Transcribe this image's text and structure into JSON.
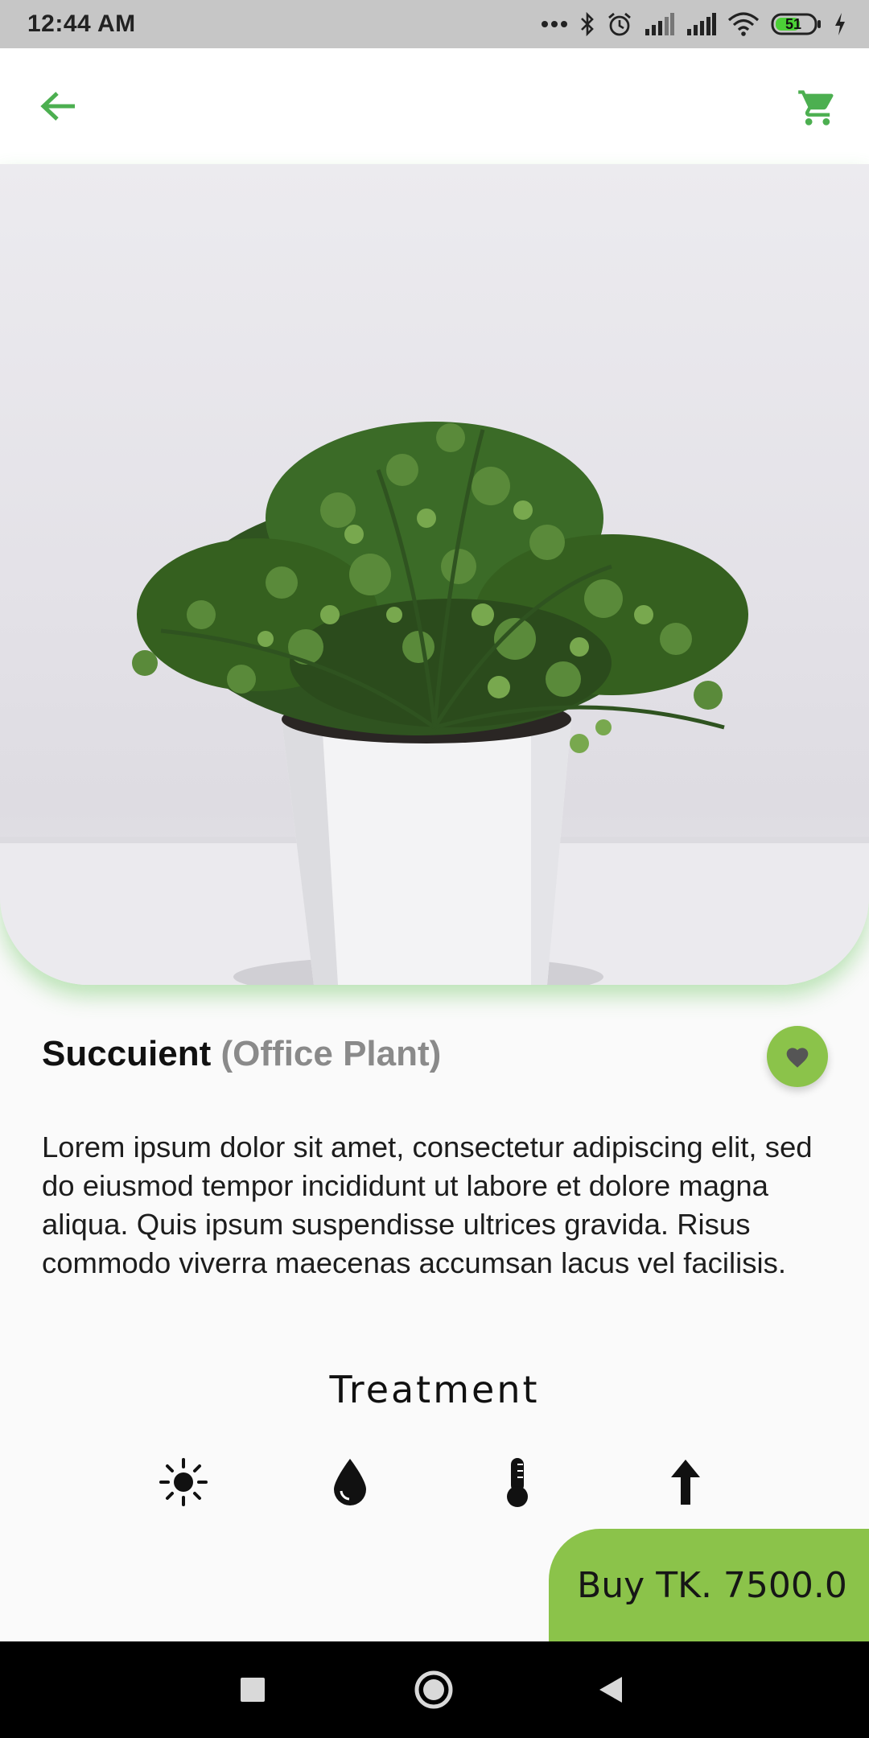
{
  "status_bar": {
    "time": "12:44 AM",
    "battery_level": "51",
    "icons": [
      "more-dots-icon",
      "bluetooth-icon",
      "alarm-icon",
      "signal-icon",
      "signal-icon",
      "wifi-icon",
      "battery-icon",
      "charging-icon"
    ]
  },
  "app_bar": {
    "back_icon": "arrow-left-icon",
    "cart_icon": "cart-icon",
    "accent_color": "#4caf50"
  },
  "product": {
    "image_subject": "potted-plant-image",
    "name": "Succuient",
    "category": "(Office Plant)",
    "favorite_icon": "heart-icon",
    "description": "Lorem ipsum dolor sit amet, consectetur adipiscing elit, sed do eiusmod tempor incididunt ut labore et dolore magna aliqua. Quis ipsum suspendisse ultrices gravida. Risus commodo viverra maecenas accumsan lacus vel facilisis."
  },
  "treatment": {
    "title": "Treatment",
    "icons": [
      "sun-icon",
      "water-drop-icon",
      "thermometer-icon",
      "arrow-up-icon"
    ]
  },
  "buy_button": {
    "label": "Buy TK. 7500.0",
    "color": "#8bc34a"
  },
  "nav_bar": {
    "icons": [
      "recents-square-icon",
      "home-circle-icon",
      "back-triangle-icon"
    ]
  }
}
